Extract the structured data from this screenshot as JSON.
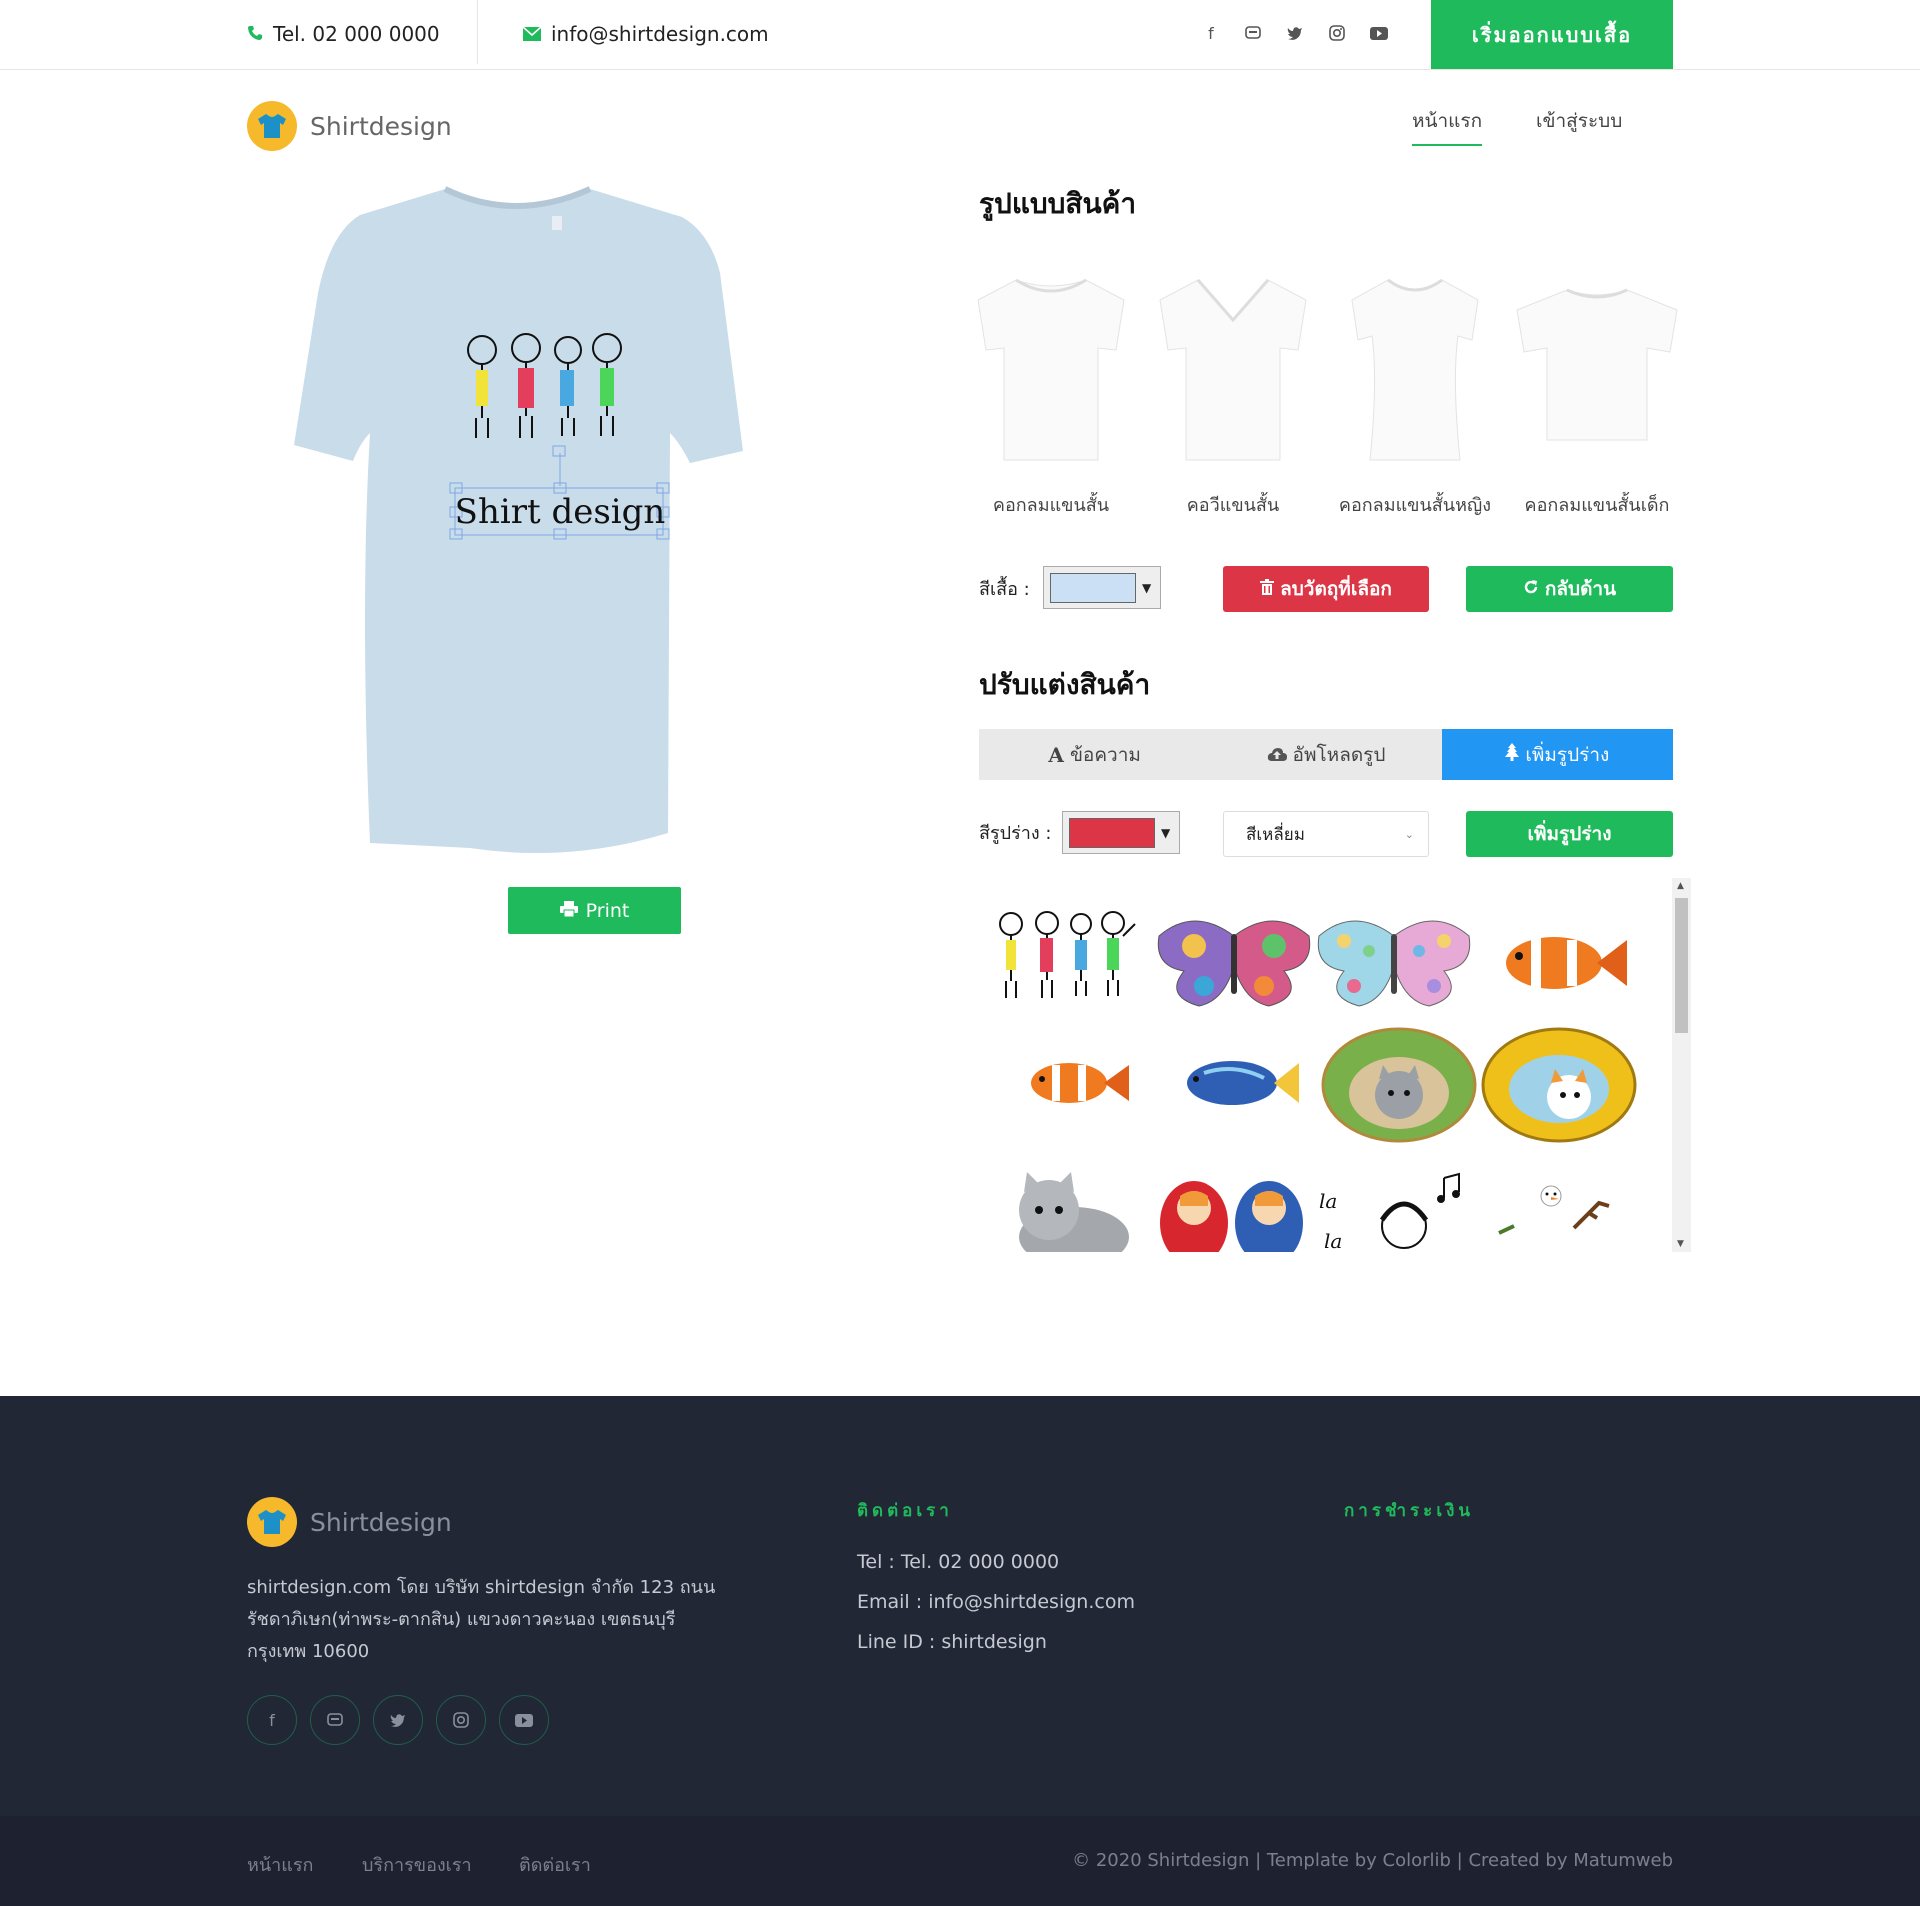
{
  "topbar": {
    "phone": "Tel. 02 000 0000",
    "email": "info@shirtdesign.com",
    "cta": "เริ่มออกแบบเสื้อ",
    "social_icons": [
      "facebook-icon",
      "line-icon",
      "twitter-icon",
      "instagram-icon",
      "youtube-icon"
    ]
  },
  "header": {
    "brand": "Shirtdesign",
    "nav": [
      {
        "label": "หน้าแรก",
        "active": true
      },
      {
        "label": "เข้าสู่ระบบ",
        "active": false
      }
    ]
  },
  "preview": {
    "shirt_color": "#c9dcea",
    "design_text": "Shirt design",
    "print_label": "Print"
  },
  "product_styles": {
    "title": "รูปแบบสินค้า",
    "items": [
      {
        "label": "คอกลมแขนสั้น"
      },
      {
        "label": "คอวีแขนสั้น"
      },
      {
        "label": "คอกลมแขนสั้นหญิง"
      },
      {
        "label": "คอกลมแขนสั้นเด็ก"
      }
    ]
  },
  "shirt_color_row": {
    "label": "สีเสื้อ :",
    "value": "#cce0f5",
    "delete_label": "ลบวัตถุที่เลือก",
    "flip_label": "กลับด้าน"
  },
  "customize": {
    "title": "ปรับแต่งสินค้า",
    "tabs": [
      {
        "label": "ข้อความ",
        "icon": "font-icon",
        "active": false
      },
      {
        "label": "อัพโหลดรูป",
        "icon": "cloud-upload-icon",
        "active": false
      },
      {
        "label": "เพิ่มรูปร่าง",
        "icon": "tree-icon",
        "active": true
      }
    ],
    "shape_color_label": "สีรูปร่าง :",
    "shape_color": "#dc3545",
    "shape_select": "สีเหลี่ยม",
    "add_shape_label": "เพิ่มรูปร่าง"
  },
  "gallery": {
    "items": [
      "kids-clipart",
      "butterfly-clipart",
      "butterfly-dots-clipart",
      "clownfish-clipart",
      "clownfish-small-clipart",
      "tropical-fish-clipart",
      "cat-stone-clipart",
      "calico-cat-stone-clipart",
      "tabby-cat-clipart",
      "matryoshka-clipart",
      "singing-boy-clipart",
      "snowman-clipart"
    ]
  },
  "footer": {
    "brand": "Shirtdesign",
    "about": "shirtdesign.com โดย บริษัท shirtdesign จำกัด 123 ถนนรัชดาภิเษก(ท่าพระ-ตากสิน) แขวงดาวคะนอง เขตธนบุรี กรุงเทพ 10600",
    "contact_heading": "ติดต่อเรา",
    "contact_lines": [
      "Tel : Tel. 02 000 0000",
      "Email : info@shirtdesign.com",
      "Line ID : shirtdesign"
    ],
    "payment_heading": "การชำระเงิน",
    "bottom_links": [
      "หน้าแรก",
      "บริการของเรา",
      "ติดต่อเรา"
    ],
    "copyright": "© 2020 Shirtdesign | Template by Colorlib | Created by Matumweb"
  }
}
